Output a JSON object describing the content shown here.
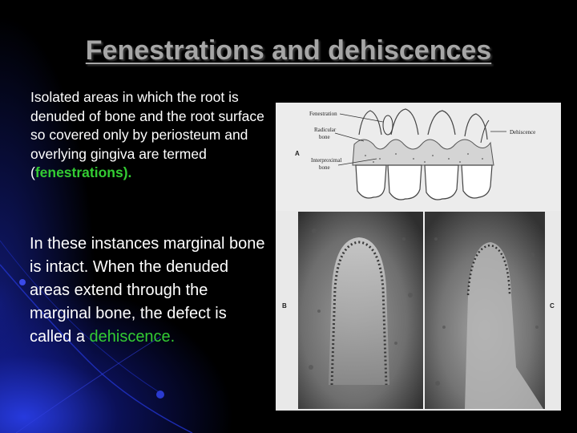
{
  "slide": {
    "title": "Fenestrations and dehiscences",
    "paragraph1": {
      "text": "Isolated areas in which the root is denuded of bone and the root surface so covered only by periosteum and overlying gingiva are termed (",
      "highlight": "fenestrations).",
      "highlight_color": "#33cc33"
    },
    "paragraph2": {
      "text": "In these instances marginal bone is intact. When the denuded areas extend through the marginal bone, the defect is called a ",
      "highlight": "dehiscence.",
      "highlight_color": "#33cc33"
    }
  },
  "figure": {
    "labels": {
      "fenestration": "Fenestration",
      "radicular_bone_1": "Radicular",
      "radicular_bone_2": "bone",
      "interproximal_bone_1": "Interproximal",
      "interproximal_bone_2": "bone",
      "dehiscence": "Dehiscence",
      "panel_a": "A",
      "panel_b": "B",
      "panel_c": "C"
    }
  },
  "colors": {
    "background": "#000000",
    "title": "#a6a6a6",
    "body_text": "#ffffff",
    "accent_glow": "#2a3ce6"
  }
}
